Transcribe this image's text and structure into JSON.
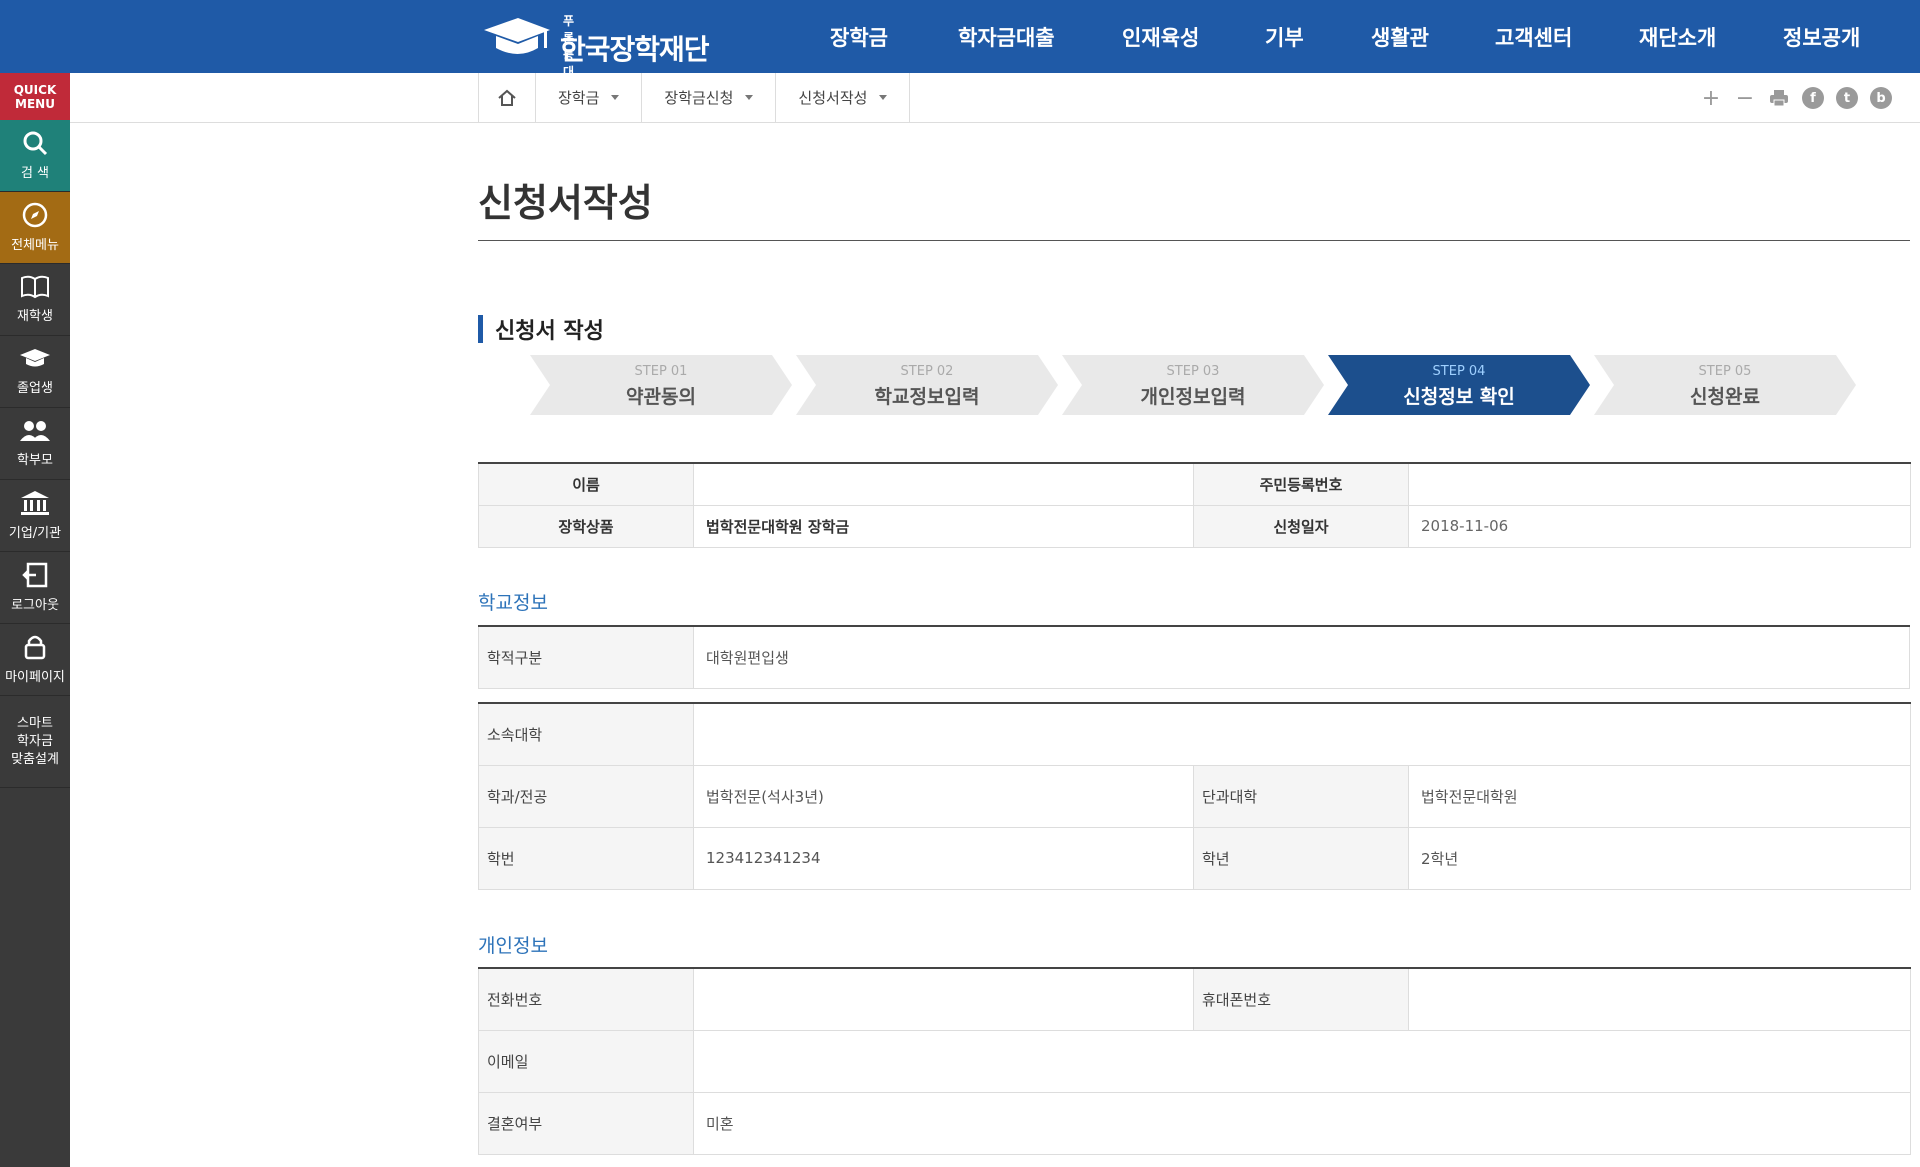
{
  "header": {
    "logo_small": "푸른등대",
    "logo_big": "한국장학재단",
    "nav": [
      "장학금",
      "학자금대출",
      "인재육성",
      "기부",
      "생활관",
      "고객센터",
      "재단소개",
      "정보공개"
    ]
  },
  "quick_menu": {
    "title_line1": "QUICK",
    "title_line2": "MENU",
    "items": [
      {
        "label": "검 색",
        "icon": "search-icon"
      },
      {
        "label": "전체메뉴",
        "icon": "compass-icon"
      },
      {
        "label": "재학생",
        "icon": "book-icon"
      },
      {
        "label": "졸업생",
        "icon": "graduation-cap-icon"
      },
      {
        "label": "학부모",
        "icon": "users-icon"
      },
      {
        "label": "기업/기관",
        "icon": "building-icon"
      },
      {
        "label": "로그아웃",
        "icon": "logout-icon"
      },
      {
        "label": "마이페이지",
        "icon": "lock-icon"
      }
    ],
    "smart_line1": "스마트",
    "smart_line2": "학자금",
    "smart_line3": "맞춤설계"
  },
  "breadcrumb": [
    "장학금",
    "장학금신청",
    "신청서작성"
  ],
  "tools": {
    "plus": "+",
    "minus": "−",
    "facebook": "f",
    "twitter": "t",
    "blog": "b"
  },
  "page": {
    "title": "신청서작성",
    "section_title": "신청서 작성"
  },
  "steps": [
    {
      "label": "STEP 01",
      "name": "약관동의",
      "active": false
    },
    {
      "label": "STEP 02",
      "name": "학교정보입력",
      "active": false
    },
    {
      "label": "STEP 03",
      "name": "개인정보입력",
      "active": false
    },
    {
      "label": "STEP 04",
      "name": "신청정보 확인",
      "active": true
    },
    {
      "label": "STEP 05",
      "name": "신청완료",
      "active": false
    }
  ],
  "summary": {
    "name_label": "이름",
    "name_value": "",
    "rrn_label": "주민등록번호",
    "rrn_value": "",
    "product_label": "장학상품",
    "product_value": "법학전문대학원 장학금",
    "date_label": "신청일자",
    "date_value": "2018-11-06"
  },
  "school": {
    "heading": "학교정보",
    "status_label": "학적구분",
    "status_value": "대학원편입생",
    "univ_label": "소속대학",
    "univ_value": "",
    "major_label": "학과/전공",
    "major_value": "법학전문(석사3년)",
    "college_label": "단과대학",
    "college_value": "법학전문대학원",
    "id_label": "학번",
    "id_value": "123412341234",
    "grade_label": "학년",
    "grade_value": "2학년"
  },
  "personal": {
    "heading": "개인정보",
    "phone_label": "전화번호",
    "phone_value": "",
    "mobile_label": "휴대폰번호",
    "mobile_value": "",
    "email_label": "이메일",
    "email_value": "",
    "marital_label": "결혼여부",
    "marital_value": "미혼"
  }
}
